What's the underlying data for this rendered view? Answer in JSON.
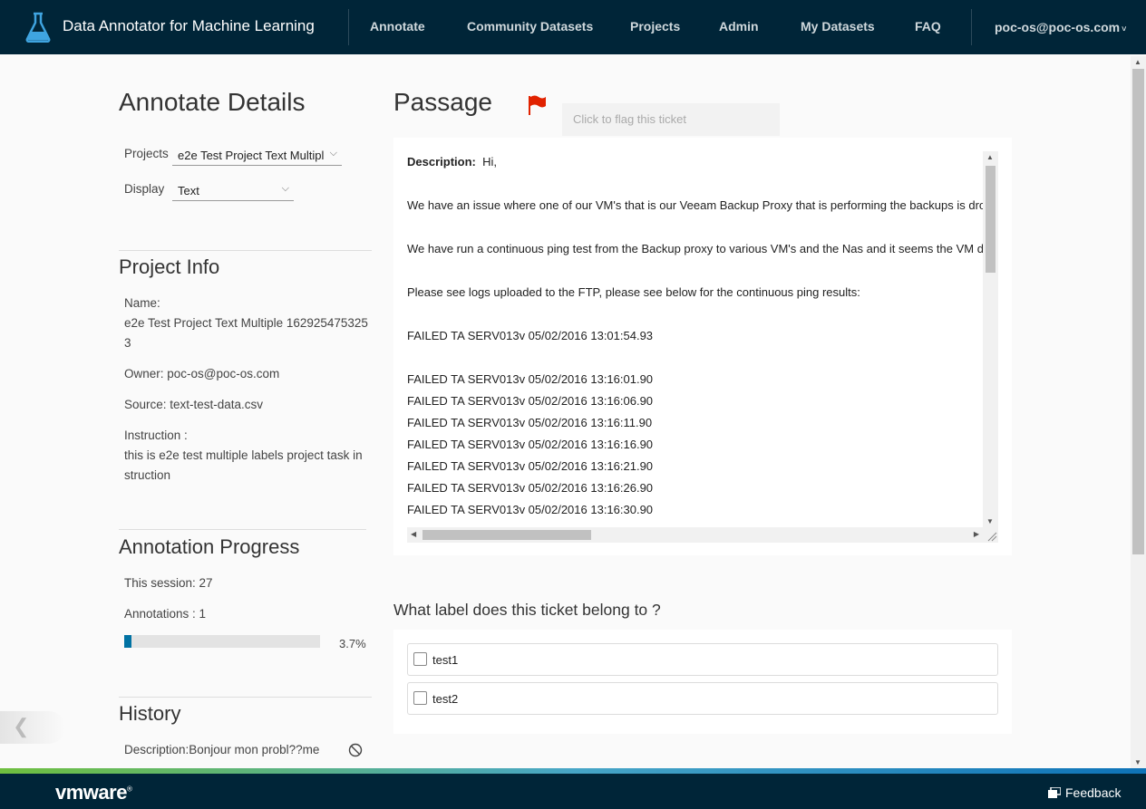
{
  "header": {
    "app_title": "Data Annotator for Machine Learning",
    "nav": [
      "Annotate",
      "Community Datasets",
      "Projects",
      "Admin",
      "My Datasets",
      "FAQ"
    ],
    "user": "poc-os@poc-os.com",
    "user_chevron": "˅"
  },
  "left": {
    "title": "Annotate Details",
    "projects_label": "Projects",
    "projects_value": "e2e Test Project Text Multipl",
    "display_label": "Display",
    "display_value": "Text",
    "project_info": {
      "heading": "Project Info",
      "name_label": "Name:",
      "name_value": "e2e Test Project Text Multiple 1629254753253",
      "owner": "Owner:  poc-os@poc-os.com",
      "source": "Source:  text-test-data.csv",
      "instruction_label": "Instruction :",
      "instruction_value": "this is e2e test multiple labels project task instruction"
    },
    "progress": {
      "heading": "Annotation Progress",
      "session": "This session:  27",
      "annotations": "Annotations :  1",
      "percent": "3.7%",
      "fraction": 0.037
    },
    "history": {
      "heading": "History",
      "item": "Description:Bonjour mon probl??me"
    }
  },
  "passage": {
    "heading": "Passage",
    "flag_tooltip": "Click to flag this ticket",
    "desc_label": "Description",
    "lines": [
      "Hi,",
      "",
      "We have an issue where one of our VM's that is our Veeam Backup Proxy that is performing the backups is dropping connectivity.",
      "",
      "We have run a continuous ping test from the Backup proxy to various VM's and the Nas and it seems the VM drops connectivity at random intervals.",
      "",
      "Please see logs uploaded to the FTP, please see below for the continuous ping results:",
      "",
      "FAILED TA SERV013v  05/02/2016 13:01:54.93",
      "",
      "FAILED TA SERV013v  05/02/2016 13:16:01.90",
      "FAILED TA SERV013v  05/02/2016 13:16:06.90",
      "FAILED TA SERV013v  05/02/2016 13:16:11.90",
      "FAILED TA SERV013v  05/02/2016 13:16:16.90",
      "FAILED TA SERV013v  05/02/2016 13:16:21.90",
      "FAILED TA SERV013v  05/02/2016 13:16:26.90",
      "FAILED TA SERV013v  05/02/2016 13:16:30.90"
    ]
  },
  "question": {
    "text": "What label does this ticket belong to ?",
    "options": [
      "test1",
      "test2"
    ]
  },
  "footer": {
    "brand": "vmware",
    "brand_mark": "®",
    "feedback": "Feedback"
  },
  "colors": {
    "header_bg": "#002538",
    "accent": "#0072a3",
    "flag": "#e12200"
  }
}
